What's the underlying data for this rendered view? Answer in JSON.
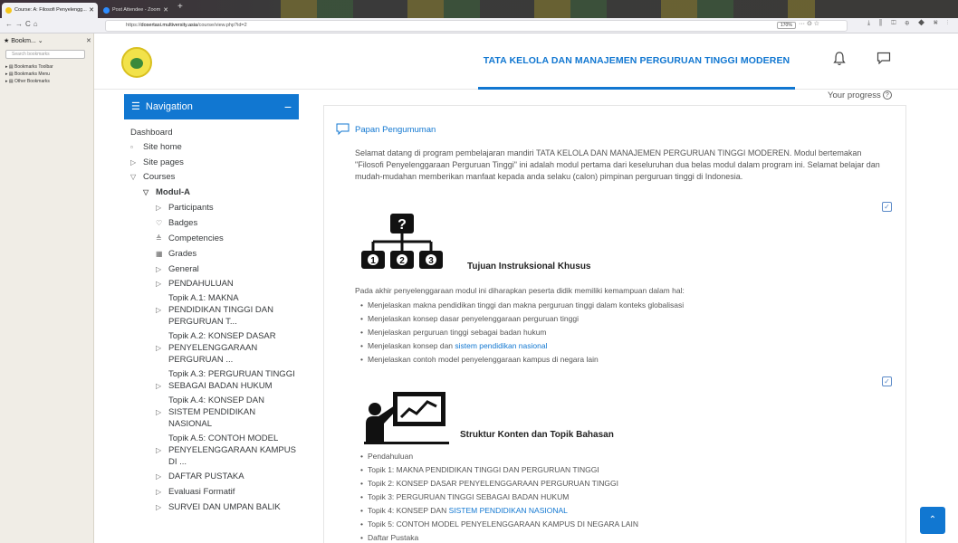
{
  "browser": {
    "tabs": [
      {
        "label": "Course: A: Filosofi Penyelengg...",
        "active": true,
        "color": "#f5c518"
      },
      {
        "label": "Post Attendee - Zoom",
        "active": false,
        "color": "#2d8cff"
      }
    ],
    "new_tab": "+",
    "url_prefix": "https://",
    "url_domain": "dosertasi.multiversity.asia",
    "url_path": "/course/view.php?id=2",
    "zoom": "170%",
    "url_icons": "··· ⊙ ☆",
    "toolbar_icons": "⤓ ⫼ ◫ ⊕ ◆ ⌘ ⋮"
  },
  "bookmarks": {
    "title": "★ Bookm...  ⌄",
    "close": "✕",
    "search_placeholder": "Search bookmarks",
    "items": [
      "Bookmarks Toolbar",
      "Bookmarks Menu",
      "Other Bookmarks"
    ]
  },
  "header": {
    "site_title": "TATA KELOLA DAN MANAJEMEN PERGURUAN TINGGI MODEREN",
    "progress_label": "Your progress",
    "progress_icon": "?"
  },
  "nav": {
    "header_icon": "☰",
    "header_label": "Navigation",
    "collapse": "−",
    "items": [
      {
        "label": "Dashboard",
        "icon": ""
      },
      {
        "label": "Site home",
        "icon": "▫"
      },
      {
        "label": "Site pages",
        "icon": "▷"
      },
      {
        "label": "Courses",
        "icon": "▽"
      },
      {
        "label": "Modul-A",
        "icon": "▽"
      },
      {
        "label": "Participants",
        "icon": "▷"
      },
      {
        "label": "Badges",
        "icon": "♡"
      },
      {
        "label": "Competencies",
        "icon": "≜"
      },
      {
        "label": "Grades",
        "icon": "▦"
      },
      {
        "label": "General",
        "icon": "▷"
      },
      {
        "label": "PENDAHULUAN",
        "icon": "▷"
      },
      {
        "label": "Topik A.1: MAKNA",
        "icon": ""
      },
      {
        "label": "PENDIDIKAN TINGGI DAN",
        "icon": "▷"
      },
      {
        "label": "PERGURUAN T...",
        "icon": ""
      },
      {
        "label": "Topik A.2: KONSEP DASAR",
        "icon": ""
      },
      {
        "label": "PENYELENGGARAAN",
        "icon": "▷"
      },
      {
        "label": "PERGURUAN ...",
        "icon": ""
      },
      {
        "label": "Topik A.3: PERGURUAN TINGGI",
        "icon": ""
      },
      {
        "label": "SEBAGAI BADAN HUKUM",
        "icon": "▷"
      },
      {
        "label": "Topik A.4: KONSEP DAN",
        "icon": ""
      },
      {
        "label": "SISTEM PENDIDIKAN",
        "icon": "▷"
      },
      {
        "label": "NASIONAL",
        "icon": ""
      },
      {
        "label": "Topik A.5: CONTOH MODEL",
        "icon": ""
      },
      {
        "label": "PENYELENGGARAAN KAMPUS",
        "icon": "▷"
      },
      {
        "label": "DI ...",
        "icon": ""
      },
      {
        "label": "DAFTAR PUSTAKA",
        "icon": "▷"
      },
      {
        "label": "Evaluasi Formatif",
        "icon": "▷"
      },
      {
        "label": "SURVEI DAN UMPAN BALIK",
        "icon": "▷"
      }
    ]
  },
  "content": {
    "forum_title": "Papan Pengumuman",
    "intro": "Selamat datang di program pembelajaran mandiri TATA KELOLA DAN MANAJEMEN PERGURUAN TINGGI MODEREN. Modul bertemakan \"Filosofi Penyelenggaraan Perguruan Tinggi\" ini adalah modul pertama dari keseluruhan dua belas modul dalam program ini. Selamat belajar dan mudah-mudahan memberikan manfaat kepada anda selaku (calon) pimpinan perguruan tinggi di Indonesia.",
    "check": "✓",
    "tik_title": "Tujuan Instruksional Khusus",
    "tik_para": "Pada akhir penyelenggaraan modul ini diharapkan peserta didik memiliki kemampuan dalam hal:",
    "tik_bullets": [
      "Menjelaskan makna pendidikan tinggi dan makna perguruan tinggi dalam konteks globalisasi",
      "Menjelaskan konsep dasar penyelenggaraan perguruan tinggi",
      "Menjelaskan perguruan tinggi sebagai badan hukum",
      "Menjelaskan konsep dan ",
      "Menjelaskan contoh model penyelenggaraan kampus di negara lain"
    ],
    "tik_link": "sistem pendidikan nasional",
    "org_question": "?",
    "org_numbers": [
      "1",
      "2",
      "3"
    ],
    "struktur_title": "Struktur Konten dan Topik Bahasan",
    "struktur_bullets": [
      "Pendahuluan",
      "Topik 1: MAKNA PENDIDIKAN TINGGI DAN PERGURUAN TINGGI",
      "Topik 2: KONSEP DASAR PENYELENGGARAAN PERGURUAN TINGGI",
      "Topik 3: PERGURUAN TINGGI SEBAGAI BADAN HUKUM",
      "Topik 4: KONSEP DAN ",
      "Topik 5: CONTOH MODEL PENYELENGGARAAN KAMPUS DI NEGARA LAIN",
      "Daftar Pustaka"
    ],
    "struktur_link": "SISTEM PENDIDIKAN NASIONAL"
  },
  "scroll_top": "⌃"
}
